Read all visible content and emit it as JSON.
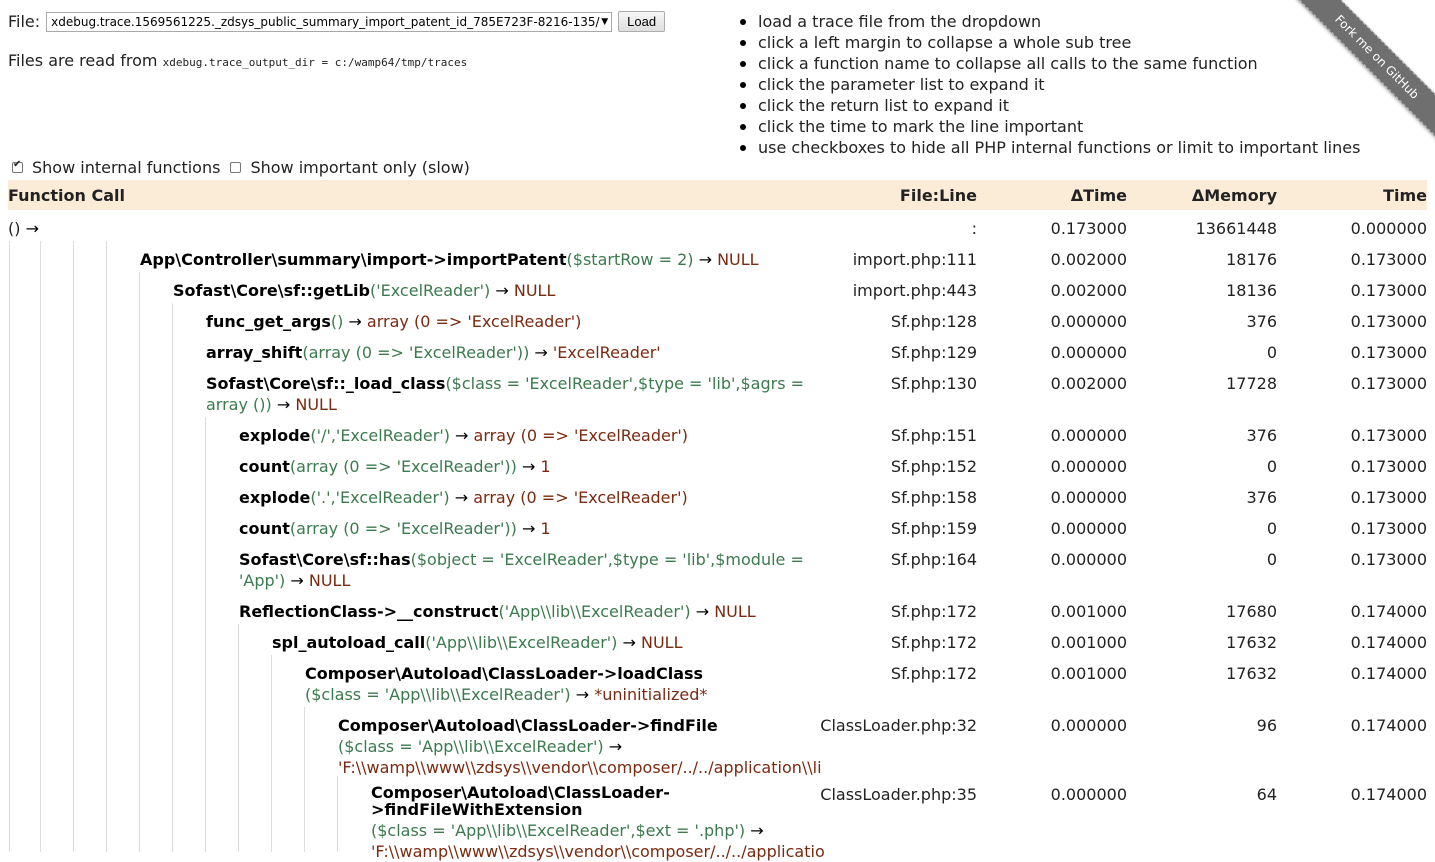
{
  "top": {
    "file_label": "File:",
    "file_value": "xdebug.trace.1569561225._zdsys_public_summary_import_patent_id_785E723F-8216-135/",
    "load_label": "Load",
    "files_read_text": "Files are read from",
    "files_read_path": "xdebug.trace_output_dir = c:/wamp64/tmp/traces"
  },
  "instructions": [
    "load a trace file from the dropdown",
    "click a left margin to collapse a whole sub tree",
    "click a function name to collapse all calls to the same function",
    "click the parameter list to expand it",
    "click the return list to expand it",
    "click the time to mark the line important",
    "use checkboxes to hide all PHP internal functions or limit to important lines"
  ],
  "ribbon": "Fork me on GitHub",
  "options": {
    "internal_label": "Show internal functions",
    "internal_checked": true,
    "important_label": "Show important only (slow)",
    "important_checked": false
  },
  "table": {
    "headers": {
      "function_call": "Function Call",
      "file_line": "File:Line",
      "dtime": "ΔTime",
      "dmemory": "ΔMemory",
      "time": "Time"
    },
    "rows": [
      {
        "fn": "",
        "params": "()",
        "ret": "",
        "file": ":",
        "dtime": "0.173000",
        "dmem": "13661448",
        "time": "0.000000"
      },
      {
        "fn": "App\\Controller\\summary\\import->importPatent",
        "params": "($startRow = 2)",
        "ret": "NULL",
        "file": "import.php:111",
        "dtime": "0.002000",
        "dmem": "18176",
        "time": "0.173000"
      },
      {
        "fn": "Sofast\\Core\\sf::getLib",
        "params": "('ExcelReader')",
        "ret": "NULL",
        "file": "import.php:443",
        "dtime": "0.002000",
        "dmem": "18136",
        "time": "0.173000"
      },
      {
        "fn": "func_get_args",
        "params": "()",
        "ret": "array (0 => 'ExcelReader')",
        "file": "Sf.php:128",
        "dtime": "0.000000",
        "dmem": "376",
        "time": "0.173000"
      },
      {
        "fn": "array_shift",
        "params": "(array (0 => 'ExcelReader'))",
        "ret": "'ExcelReader'",
        "file": "Sf.php:129",
        "dtime": "0.000000",
        "dmem": "0",
        "time": "0.173000"
      },
      {
        "fn": "Sofast\\Core\\sf::_load_class",
        "params": "($class = 'ExcelReader',$type = 'lib',$agrs = array ())",
        "ret": "NULL",
        "file": "Sf.php:130",
        "dtime": "0.002000",
        "dmem": "17728",
        "time": "0.173000"
      },
      {
        "fn": "explode",
        "params": "('/','ExcelReader')",
        "ret": "array (0 => 'ExcelReader')",
        "file": "Sf.php:151",
        "dtime": "0.000000",
        "dmem": "376",
        "time": "0.173000"
      },
      {
        "fn": "count",
        "params": "(array (0 => 'ExcelReader'))",
        "ret": "1",
        "file": "Sf.php:152",
        "dtime": "0.000000",
        "dmem": "0",
        "time": "0.173000"
      },
      {
        "fn": "explode",
        "params": "('.','ExcelReader')",
        "ret": "array (0 => 'ExcelReader')",
        "file": "Sf.php:158",
        "dtime": "0.000000",
        "dmem": "376",
        "time": "0.173000"
      },
      {
        "fn": "count",
        "params": "(array (0 => 'ExcelReader'))",
        "ret": "1",
        "file": "Sf.php:159",
        "dtime": "0.000000",
        "dmem": "0",
        "time": "0.173000"
      },
      {
        "fn": "Sofast\\Core\\sf::has",
        "params": "($object = 'ExcelReader',$type = 'lib',$module = 'App')",
        "ret": "NULL",
        "file": "Sf.php:164",
        "dtime": "0.000000",
        "dmem": "0",
        "time": "0.173000"
      },
      {
        "fn": "ReflectionClass->__construct",
        "params": "('App\\\\lib\\\\ExcelReader')",
        "ret": "NULL",
        "file": "Sf.php:172",
        "dtime": "0.001000",
        "dmem": "17680",
        "time": "0.174000"
      },
      {
        "fn": "spl_autoload_call",
        "params": "('App\\\\lib\\\\ExcelReader')",
        "ret": "NULL",
        "file": "Sf.php:172",
        "dtime": "0.001000",
        "dmem": "17632",
        "time": "0.174000"
      },
      {
        "fn": "Composer\\Autoload\\ClassLoader->loadClass",
        "params": "($class = 'App\\\\lib\\\\ExcelReader')",
        "ret": "*uninitialized*",
        "file": "Sf.php:172",
        "dtime": "0.001000",
        "dmem": "17632",
        "time": "0.174000"
      },
      {
        "fn": "Composer\\Autoload\\ClassLoader->findFile",
        "params": "($class = 'App\\\\lib\\\\ExcelReader')",
        "ret": "'F:\\\\wamp\\\\www\\\\zdsys\\\\vendor\\\\composer/../../application\\\\li",
        "file": "ClassLoader.php:32",
        "dtime": "0.000000",
        "dmem": "96",
        "time": "0.174000"
      },
      {
        "fn": "Composer\\Autoload\\ClassLoader->findFileWithExtension",
        "params": "($class = 'App\\\\lib\\\\ExcelReader',$ext = '.php')",
        "ret": "'F:\\\\wamp\\\\www\\\\zdsys\\\\vendor\\\\composer/../../applicatio",
        "file": "ClassLoader.php:35",
        "dtime": "0.000000",
        "dmem": "64",
        "time": "0.174000"
      }
    ]
  }
}
